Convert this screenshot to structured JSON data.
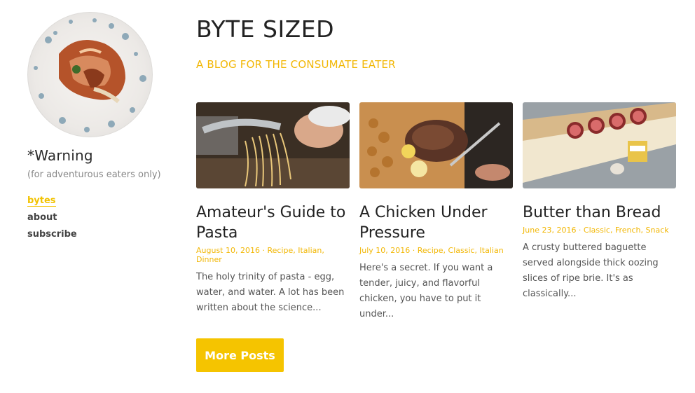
{
  "sidebar": {
    "title": "*Warning",
    "subtitle": "(for adventurous eaters only)",
    "nav": [
      {
        "label": "bytes",
        "active": true
      },
      {
        "label": "about",
        "active": false
      },
      {
        "label": "subscribe",
        "active": false
      }
    ]
  },
  "header": {
    "title": "BYTE SIZED",
    "tagline": "A BLOG FOR THE CONSUMATE EATER"
  },
  "posts": [
    {
      "title": "Amateur's Guide to Pasta",
      "meta": "August 10, 2016 · Recipe, Italian, Dinner",
      "excerpt": "The holy trinity of pasta - egg, water, and water. A lot has been written about the science..."
    },
    {
      "title": "A Chicken Under Pressure",
      "meta": "July 10, 2016 · Recipe, Classic, Italian",
      "excerpt": "Here's a secret. If you want a tender, juicy, and flavorful chicken, you have to put it under..."
    },
    {
      "title": "Butter than Bread",
      "meta": "June 23, 2016 · Classic, French, Snack",
      "excerpt": "A crusty buttered baguette served alongside thick oozing slices of ripe brie. It's as classically..."
    }
  ],
  "more_button": "More Posts",
  "colors": {
    "accent": "#f5c400",
    "text": "#333333"
  }
}
